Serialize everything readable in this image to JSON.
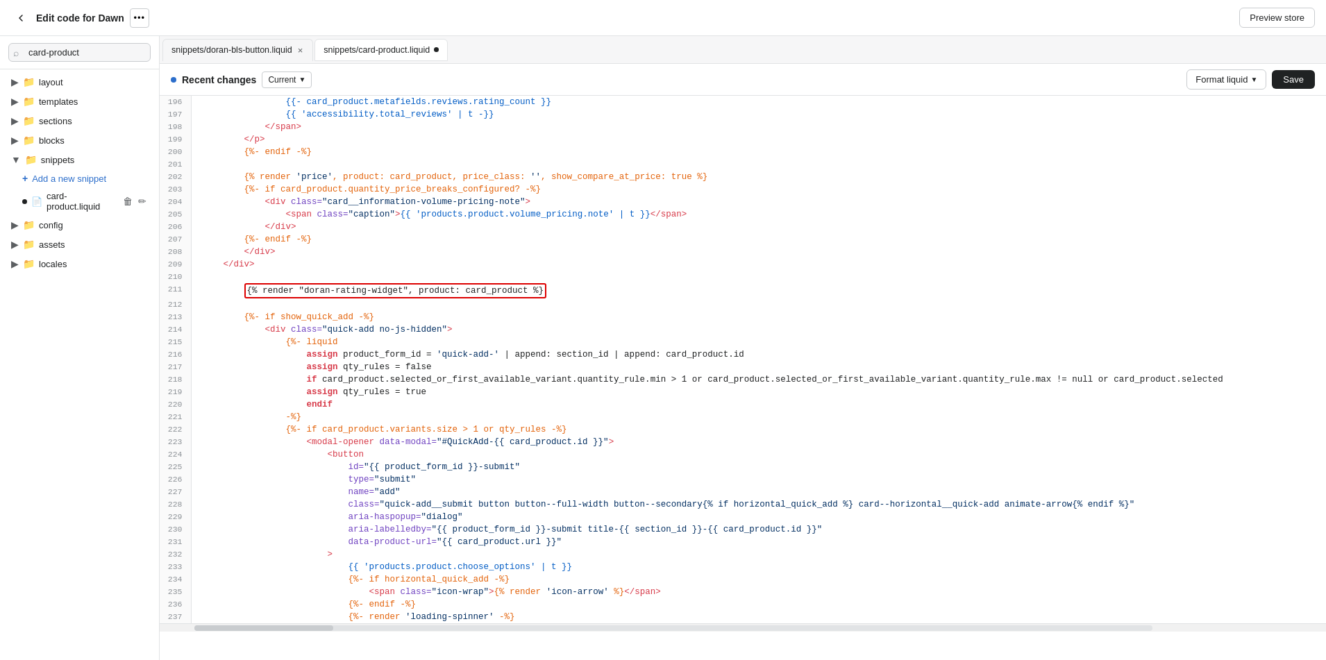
{
  "topbar": {
    "title": "Edit code for Dawn",
    "more_label": "•••",
    "preview_label": "Preview store"
  },
  "sidebar": {
    "search_placeholder": "card-product",
    "sections": [
      {
        "id": "layout",
        "label": "layout",
        "type": "folder",
        "expanded": false
      },
      {
        "id": "templates",
        "label": "templates",
        "type": "folder",
        "expanded": false
      },
      {
        "id": "sections",
        "label": "sections",
        "type": "folder",
        "expanded": false
      },
      {
        "id": "blocks",
        "label": "blocks",
        "type": "folder",
        "expanded": false
      },
      {
        "id": "snippets",
        "label": "snippets",
        "type": "folder",
        "expanded": true
      },
      {
        "id": "config",
        "label": "config",
        "type": "folder",
        "expanded": false
      },
      {
        "id": "assets",
        "label": "assets",
        "type": "folder",
        "expanded": false
      },
      {
        "id": "locales",
        "label": "locales",
        "type": "folder",
        "expanded": false
      }
    ],
    "snippets_files": [
      {
        "id": "card-product.liquid",
        "label": "card-product.liquid",
        "active": true,
        "dirty": false
      }
    ],
    "add_snippet_label": "Add a new snippet"
  },
  "tabs": [
    {
      "id": "doran-bls-button",
      "label": "snippets/doran-bls-button.liquid",
      "closeable": true,
      "dirty": false
    },
    {
      "id": "card-product",
      "label": "snippets/card-product.liquid",
      "closeable": false,
      "dirty": true,
      "active": true
    }
  ],
  "recent_bar": {
    "label": "Recent changes",
    "current_label": "Current",
    "format_liquid_label": "Format liquid",
    "save_label": "Save"
  },
  "code_lines": [
    {
      "num": 196,
      "tokens": [
        {
          "t": "plain",
          "v": "                "
        },
        {
          "t": "liquid-var",
          "v": "{{- card_product.metafields.reviews.rating_count }}"
        }
      ],
      "fold": false,
      "highlight": false
    },
    {
      "num": 197,
      "tokens": [
        {
          "t": "plain",
          "v": "                "
        },
        {
          "t": "liquid-var",
          "v": "{{ 'accessibility.total_reviews' | t -}}"
        }
      ],
      "fold": false,
      "highlight": false
    },
    {
      "num": 198,
      "tokens": [
        {
          "t": "plain",
          "v": "            "
        },
        {
          "t": "tag",
          "v": "</span>"
        }
      ],
      "fold": false,
      "highlight": false
    },
    {
      "num": 199,
      "tokens": [
        {
          "t": "plain",
          "v": "        "
        },
        {
          "t": "tag",
          "v": "</p>"
        }
      ],
      "fold": false,
      "highlight": false
    },
    {
      "num": 200,
      "tokens": [
        {
          "t": "plain",
          "v": "        "
        },
        {
          "t": "liquid-tag",
          "v": "{%- endif -%}"
        }
      ],
      "fold": false,
      "highlight": false
    },
    {
      "num": 201,
      "tokens": [],
      "fold": false,
      "highlight": false
    },
    {
      "num": 202,
      "tokens": [
        {
          "t": "plain",
          "v": "        "
        },
        {
          "t": "liquid-tag",
          "v": "{% render "
        },
        {
          "t": "liquid-str",
          "v": "'price'"
        },
        {
          "t": "liquid-tag",
          "v": ", product: card_product, price_class: "
        },
        {
          "t": "liquid-str",
          "v": "''"
        },
        {
          "t": "liquid-tag",
          "v": ", show_compare_at_price: true %}"
        }
      ],
      "fold": false,
      "highlight": false
    },
    {
      "num": 203,
      "tokens": [
        {
          "t": "plain",
          "v": "        "
        },
        {
          "t": "liquid-tag",
          "v": "{%- if card_product.quantity_price_breaks_configured? -%}"
        }
      ],
      "fold": true,
      "highlight": false
    },
    {
      "num": 204,
      "tokens": [
        {
          "t": "plain",
          "v": "            "
        },
        {
          "t": "tag",
          "v": "<div "
        },
        {
          "t": "attr-name",
          "v": "class="
        },
        {
          "t": "attr-value",
          "v": "\"card__information-volume-pricing-note\""
        },
        {
          "t": "tag",
          "v": ">"
        }
      ],
      "fold": true,
      "highlight": false
    },
    {
      "num": 205,
      "tokens": [
        {
          "t": "plain",
          "v": "                "
        },
        {
          "t": "tag",
          "v": "<span "
        },
        {
          "t": "attr-name",
          "v": "class="
        },
        {
          "t": "attr-value",
          "v": "\"caption\""
        },
        {
          "t": "tag",
          "v": ">"
        },
        {
          "t": "liquid-var",
          "v": "{{ 'products.product.volume_pricing.note' | t }}"
        },
        {
          "t": "tag",
          "v": "</span>"
        }
      ],
      "fold": false,
      "highlight": false
    },
    {
      "num": 206,
      "tokens": [
        {
          "t": "plain",
          "v": "            "
        },
        {
          "t": "tag",
          "v": "</div>"
        }
      ],
      "fold": false,
      "highlight": false
    },
    {
      "num": 207,
      "tokens": [
        {
          "t": "plain",
          "v": "        "
        },
        {
          "t": "liquid-tag",
          "v": "{%- endif -%}"
        }
      ],
      "fold": false,
      "highlight": false
    },
    {
      "num": 208,
      "tokens": [
        {
          "t": "plain",
          "v": "        "
        },
        {
          "t": "tag",
          "v": "</div>"
        }
      ],
      "fold": false,
      "highlight": false
    },
    {
      "num": 209,
      "tokens": [
        {
          "t": "plain",
          "v": "    "
        },
        {
          "t": "tag",
          "v": "</div>"
        }
      ],
      "fold": false,
      "highlight": false
    },
    {
      "num": 210,
      "tokens": [],
      "fold": false,
      "highlight": false
    },
    {
      "num": 211,
      "tokens": [
        {
          "t": "plain",
          "v": "        "
        },
        {
          "t": "render-highlight",
          "v": "{% render \"doran-rating-widget\", product: card_product %}"
        }
      ],
      "fold": false,
      "highlight": true
    },
    {
      "num": 212,
      "tokens": [],
      "fold": false,
      "highlight": false
    },
    {
      "num": 213,
      "tokens": [
        {
          "t": "plain",
          "v": "        "
        },
        {
          "t": "liquid-tag",
          "v": "{%- if show_quick_add -%}"
        }
      ],
      "fold": false,
      "highlight": false
    },
    {
      "num": 214,
      "tokens": [
        {
          "t": "plain",
          "v": "            "
        },
        {
          "t": "tag",
          "v": "<div "
        },
        {
          "t": "attr-name",
          "v": "class="
        },
        {
          "t": "attr-value",
          "v": "\"quick-add no-js-hidden\""
        },
        {
          "t": "tag",
          "v": ">"
        }
      ],
      "fold": true,
      "highlight": false
    },
    {
      "num": 215,
      "tokens": [
        {
          "t": "plain",
          "v": "                "
        },
        {
          "t": "liquid-tag",
          "v": "{%- liquid"
        }
      ],
      "fold": false,
      "highlight": false
    },
    {
      "num": 216,
      "tokens": [
        {
          "t": "plain",
          "v": "                    "
        },
        {
          "t": "liquid-keyword",
          "v": "assign"
        },
        {
          "t": "plain",
          "v": " product_form_id = "
        },
        {
          "t": "liquid-str",
          "v": "'quick-add-'"
        },
        {
          "t": "plain",
          "v": " | append: section_id | append: card_product.id"
        }
      ],
      "fold": false,
      "highlight": false
    },
    {
      "num": 217,
      "tokens": [
        {
          "t": "plain",
          "v": "                    "
        },
        {
          "t": "liquid-keyword",
          "v": "assign"
        },
        {
          "t": "plain",
          "v": " qty_rules = false"
        }
      ],
      "fold": false,
      "highlight": false
    },
    {
      "num": 218,
      "tokens": [
        {
          "t": "plain",
          "v": "                    "
        },
        {
          "t": "liquid-keyword",
          "v": "if"
        },
        {
          "t": "plain",
          "v": " card_product.selected_or_first_available_variant.quantity_rule.min > 1 or card_product.selected_or_first_available_variant.quantity_rule.max != null or card_product.selected"
        }
      ],
      "fold": false,
      "highlight": false
    },
    {
      "num": 219,
      "tokens": [
        {
          "t": "plain",
          "v": "                    "
        },
        {
          "t": "liquid-keyword",
          "v": "assign"
        },
        {
          "t": "plain",
          "v": " qty_rules = true"
        }
      ],
      "fold": false,
      "highlight": false
    },
    {
      "num": 220,
      "tokens": [
        {
          "t": "plain",
          "v": "                    "
        },
        {
          "t": "liquid-keyword",
          "v": "endif"
        }
      ],
      "fold": false,
      "highlight": false
    },
    {
      "num": 221,
      "tokens": [
        {
          "t": "plain",
          "v": "                "
        },
        {
          "t": "liquid-tag",
          "v": "-%}"
        }
      ],
      "fold": false,
      "highlight": false
    },
    {
      "num": 222,
      "tokens": [
        {
          "t": "plain",
          "v": "                "
        },
        {
          "t": "liquid-tag",
          "v": "{%- if card_product.variants.size > 1 or qty_rules -%}"
        }
      ],
      "fold": false,
      "highlight": false
    },
    {
      "num": 223,
      "tokens": [
        {
          "t": "plain",
          "v": "                    "
        },
        {
          "t": "tag",
          "v": "<modal-opener "
        },
        {
          "t": "attr-name",
          "v": "data-modal="
        },
        {
          "t": "attr-value",
          "v": "\"#QuickAdd-{{ card_product.id }}\""
        },
        {
          "t": "tag",
          "v": ">"
        }
      ],
      "fold": true,
      "highlight": false
    },
    {
      "num": 224,
      "tokens": [
        {
          "t": "plain",
          "v": "                        "
        },
        {
          "t": "tag",
          "v": "<button"
        }
      ],
      "fold": false,
      "highlight": false
    },
    {
      "num": 225,
      "tokens": [
        {
          "t": "plain",
          "v": "                            "
        },
        {
          "t": "attr-name",
          "v": "id="
        },
        {
          "t": "attr-value",
          "v": "\"{{ product_form_id }}-submit\""
        }
      ],
      "fold": false,
      "highlight": false
    },
    {
      "num": 226,
      "tokens": [
        {
          "t": "plain",
          "v": "                            "
        },
        {
          "t": "attr-name",
          "v": "type="
        },
        {
          "t": "attr-value",
          "v": "\"submit\""
        }
      ],
      "fold": false,
      "highlight": false
    },
    {
      "num": 227,
      "tokens": [
        {
          "t": "plain",
          "v": "                            "
        },
        {
          "t": "attr-name",
          "v": "name="
        },
        {
          "t": "attr-value",
          "v": "\"add\""
        }
      ],
      "fold": false,
      "highlight": false
    },
    {
      "num": 228,
      "tokens": [
        {
          "t": "plain",
          "v": "                            "
        },
        {
          "t": "attr-name",
          "v": "class="
        },
        {
          "t": "attr-value",
          "v": "\"quick-add__submit button button--full-width button--secondary{% if horizontal_quick_add %} card--horizontal__quick-add animate-arrow{% endif %}\""
        }
      ],
      "fold": false,
      "highlight": false
    },
    {
      "num": 229,
      "tokens": [
        {
          "t": "plain",
          "v": "                            "
        },
        {
          "t": "attr-name",
          "v": "aria-haspopup="
        },
        {
          "t": "attr-value",
          "v": "\"dialog\""
        }
      ],
      "fold": false,
      "highlight": false
    },
    {
      "num": 230,
      "tokens": [
        {
          "t": "plain",
          "v": "                            "
        },
        {
          "t": "attr-name",
          "v": "aria-labelledby="
        },
        {
          "t": "attr-value",
          "v": "\"{{ product_form_id }}-submit title-{{ section_id }}-{{ card_product.id }}\""
        }
      ],
      "fold": false,
      "highlight": false
    },
    {
      "num": 231,
      "tokens": [
        {
          "t": "plain",
          "v": "                            "
        },
        {
          "t": "attr-name",
          "v": "data-product-url="
        },
        {
          "t": "attr-value",
          "v": "\"{{ card_product.url }}\""
        }
      ],
      "fold": false,
      "highlight": false
    },
    {
      "num": 232,
      "tokens": [
        {
          "t": "plain",
          "v": "                        "
        },
        {
          "t": "tag",
          "v": ">"
        }
      ],
      "fold": true,
      "highlight": false
    },
    {
      "num": 233,
      "tokens": [
        {
          "t": "plain",
          "v": "                            "
        },
        {
          "t": "liquid-var",
          "v": "{{ 'products.product.choose_options' | t }}"
        }
      ],
      "fold": false,
      "highlight": false
    },
    {
      "num": 234,
      "tokens": [
        {
          "t": "plain",
          "v": "                            "
        },
        {
          "t": "liquid-tag",
          "v": "{%- if horizontal_quick_add -%}"
        }
      ],
      "fold": false,
      "highlight": false
    },
    {
      "num": 235,
      "tokens": [
        {
          "t": "plain",
          "v": "                                "
        },
        {
          "t": "tag",
          "v": "<span "
        },
        {
          "t": "attr-name",
          "v": "class="
        },
        {
          "t": "attr-value",
          "v": "\"icon-wrap\""
        },
        {
          "t": "tag",
          "v": ">"
        },
        {
          "t": "liquid-tag",
          "v": "{% render "
        },
        {
          "t": "liquid-str",
          "v": "'icon-arrow'"
        },
        {
          "t": "liquid-tag",
          "v": " %}"
        },
        {
          "t": "tag",
          "v": "</span>"
        }
      ],
      "fold": false,
      "highlight": false
    },
    {
      "num": 236,
      "tokens": [
        {
          "t": "plain",
          "v": "                            "
        },
        {
          "t": "liquid-tag",
          "v": "{%- endif -%}"
        }
      ],
      "fold": false,
      "highlight": false
    },
    {
      "num": 237,
      "tokens": [
        {
          "t": "plain",
          "v": "                            "
        },
        {
          "t": "liquid-tag",
          "v": "{%- render "
        },
        {
          "t": "liquid-str",
          "v": "'loading-spinner'"
        },
        {
          "t": "liquid-tag",
          "v": " -%}"
        }
      ],
      "fold": false,
      "highlight": false
    }
  ]
}
